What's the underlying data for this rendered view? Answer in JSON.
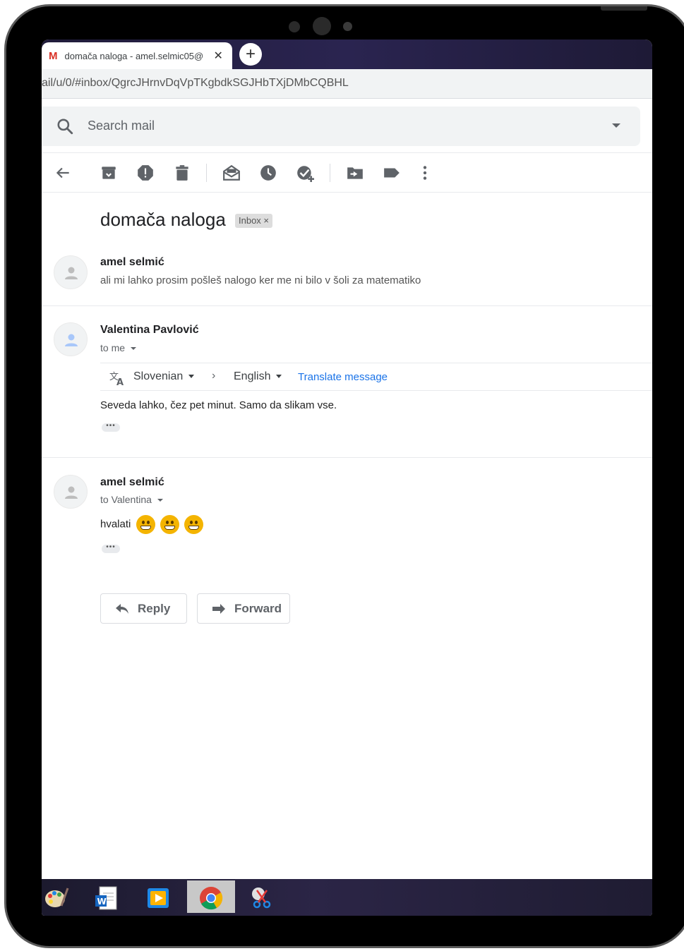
{
  "browser": {
    "tab_title": "domača naloga - amel.selmic05@",
    "tab_close": "✕",
    "new_tab": "+",
    "url": "ail/u/0/#inbox/QgrcJHrnvDqVpTKgbdkSGJHbTXjDMbCQBHL"
  },
  "search": {
    "placeholder": "Search mail"
  },
  "toolbar": {
    "icons": [
      "back-arrow-icon",
      "archive-icon",
      "report-spam-icon",
      "delete-icon",
      "mark-unread-icon",
      "snooze-icon",
      "add-to-tasks-icon",
      "move-to-icon",
      "labels-icon",
      "more-icon"
    ]
  },
  "thread": {
    "subject": "domača naloga",
    "label_chip": "Inbox ×",
    "messages": [
      {
        "sender": "amel selmić",
        "snippet": "ali mi lahko prosim pošleš nalogo ker me ni bilo v šoli za matematiko"
      },
      {
        "sender": "Valentina Pavlović",
        "to": "to me",
        "translate": {
          "from": "Slovenian",
          "arrow": "›",
          "to": "English",
          "link": "Translate message"
        },
        "body": "Seveda lahko, čez pet minut. Samo da slikam vse.",
        "more": "•••"
      },
      {
        "sender": "amel selmić",
        "to": "to Valentina",
        "body": "hvalati",
        "emoji": [
          "grinning-face",
          "grinning-face",
          "grinning-face"
        ],
        "more": "•••"
      }
    ],
    "reply_label": "Reply",
    "forward_label": "Forward"
  },
  "taskbar": {
    "apps": [
      "paint-icon",
      "word-icon",
      "media-player-icon",
      "chrome-icon",
      "snipping-tool-icon"
    ],
    "active_app": "chrome-icon"
  },
  "colors": {
    "link": "#1a73e8",
    "gmail_red": "#d93025",
    "emoji": "#f4b400"
  }
}
